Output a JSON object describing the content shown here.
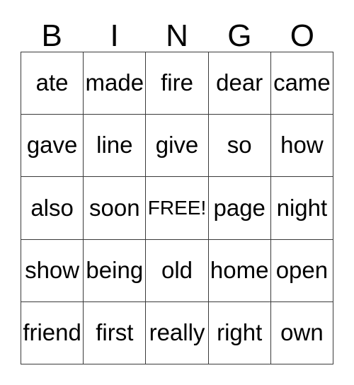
{
  "card": {
    "header_letters": [
      "B",
      "I",
      "N",
      "G",
      "O"
    ],
    "grid": [
      [
        "ate",
        "made",
        "fire",
        "dear",
        "came"
      ],
      [
        "gave",
        "line",
        "give",
        "so",
        "how"
      ],
      [
        "also",
        "soon",
        "FREE!",
        "page",
        "night"
      ],
      [
        "show",
        "being",
        "old",
        "home",
        "open"
      ],
      [
        "friend",
        "first",
        "really",
        "right",
        "own"
      ]
    ],
    "free_space": {
      "row": 2,
      "col": 2,
      "label": "FREE!"
    },
    "colors": {
      "background": "#ffffff",
      "text": "#000000",
      "grid_line": "#3a3a3a"
    }
  }
}
